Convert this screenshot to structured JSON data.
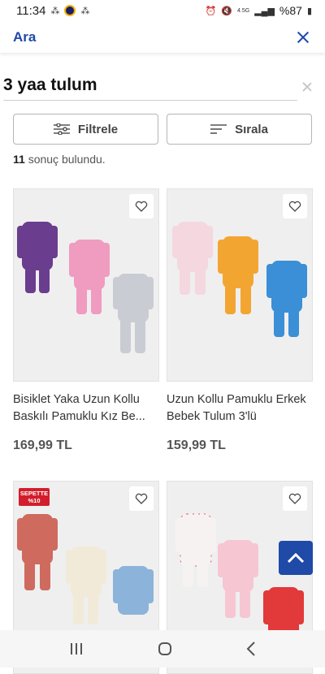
{
  "status": {
    "time": "11:34",
    "battery": "%87",
    "network": "4.5G"
  },
  "header": {
    "title": "Ara"
  },
  "search": {
    "value": "3 yaa tulum"
  },
  "actions": {
    "filter_label": "Filtrele",
    "sort_label": "Sırala"
  },
  "results": {
    "count": "11",
    "suffix": "sonuç bulundu."
  },
  "products": [
    {
      "title": "Bisiklet Yaka Uzun Kollu Baskılı Pamuklu Kız Be...",
      "price": "169,99 TL"
    },
    {
      "title": "Uzun Kollu Pamuklu Erkek Bebek Tulum 3'lü",
      "price": "159,99 TL"
    },
    {
      "title": "",
      "price": "",
      "promo": "SEPETTE %10"
    },
    {
      "title": "",
      "price": ""
    }
  ],
  "colors": {
    "brand": "#1f4aa8",
    "promo": "#d21d2b"
  }
}
